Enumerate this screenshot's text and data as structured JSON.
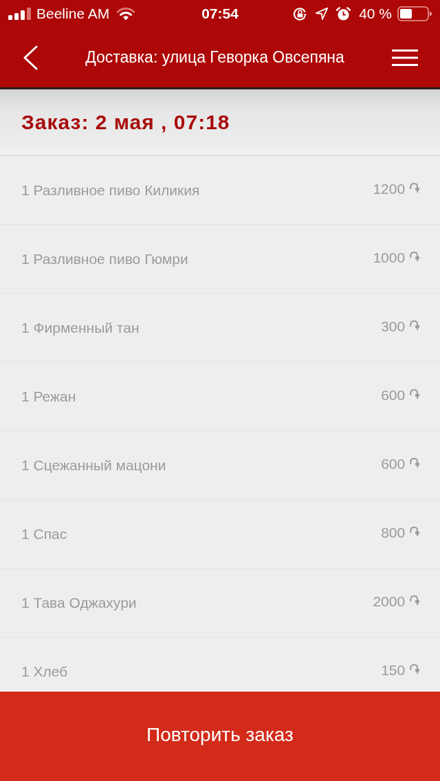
{
  "status_bar": {
    "carrier": "Beeline AM",
    "time": "07:54",
    "battery": "40 %"
  },
  "nav_bar": {
    "title": "Доставка: улица Геворка Овсепяна"
  },
  "order": {
    "title": "Заказ: 2 мая , 07:18"
  },
  "items": [
    {
      "name": "1 Разливное пиво Киликия",
      "price": "1200 ֏"
    },
    {
      "name": "1 Разливное пиво Гюмри",
      "price": "1000 ֏"
    },
    {
      "name": "1 Фирменный тан",
      "price": "300 ֏"
    },
    {
      "name": "1 Режан",
      "price": "600 ֏"
    },
    {
      "name": "1 Сцежанный мацони",
      "price": "600 ֏"
    },
    {
      "name": "1 Спас",
      "price": "800 ֏"
    },
    {
      "name": "1 Тава Оджахури",
      "price": "2000 ֏"
    },
    {
      "name": "1 Хлеб",
      "price": "150 ֏"
    }
  ],
  "button": "Повторить заказ"
}
